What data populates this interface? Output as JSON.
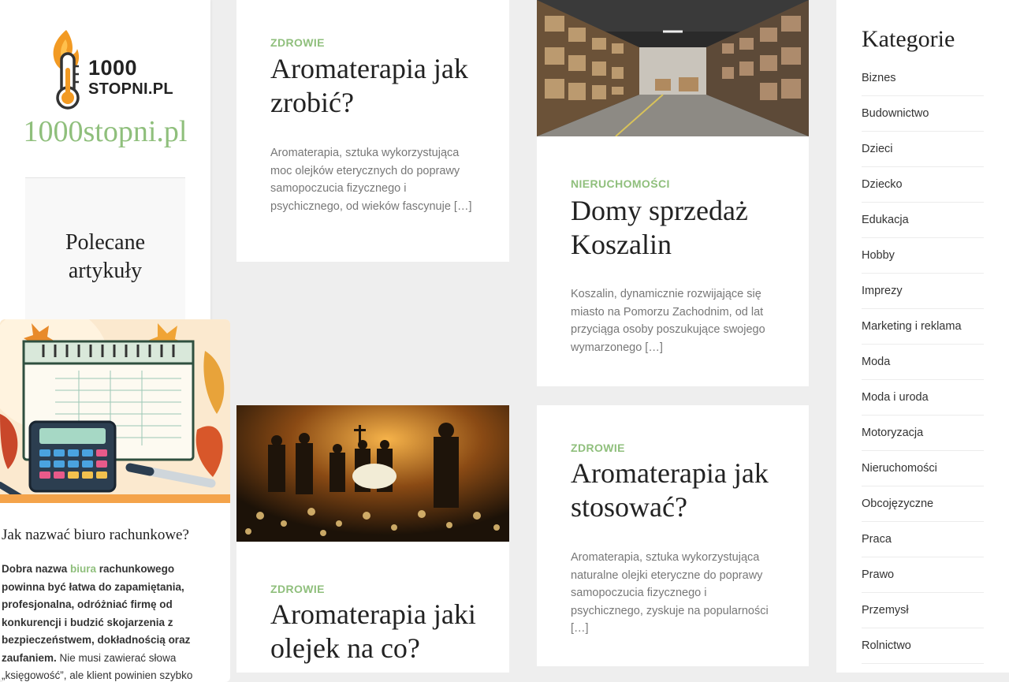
{
  "site": {
    "logo_number": "1000",
    "logo_domain": "STOPNI.PL",
    "title": "1000stopni.pl"
  },
  "featured": {
    "heading_line1": "Polecane",
    "heading_line2": "artykuły",
    "article": {
      "title": "Jak nazwać biuro rachunkowe?",
      "excerpt_bold_1": "Dobra nazwa ",
      "excerpt_link": "biura",
      "excerpt_bold_2": " rachunkowego powinna być łatwa do zapamiętania, profesjonalna, odróżniać firmę od konkurencji i budzić skojarzenia z bezpieczeństwem, dokładnością oraz zaufaniem.",
      "excerpt_rest": " Nie musi zawierać słowa „księgowość”, ale klient powinien szybko"
    }
  },
  "posts": [
    {
      "category": "ZDROWIE",
      "title": "Aromaterapia jak zrobić?",
      "excerpt": "Aromaterapia, sztuka wykorzystująca moc olejków eterycznych do poprawy samopoczucia fizycznego i psychicznego, od wieków fascynuje […]"
    },
    {
      "category": "NIERUCHOMOŚCI",
      "title": "Domy sprzedaż Koszalin",
      "excerpt": "Koszalin, dynamicznie rozwijające się miasto na Pomorzu Zachodnim, od lat przyciąga osoby poszukujące swojego wymarzonego […]"
    },
    {
      "category": "ZDROWIE",
      "title": "Aromaterapia jaki olejek na co?",
      "excerpt": ""
    },
    {
      "category": "ZDROWIE",
      "title": "Aromaterapia jak stosować?",
      "excerpt": "Aromaterapia, sztuka wykorzystująca naturalne olejki eteryczne do poprawy samopoczucia fizycznego i psychicznego, zyskuje na popularności […]"
    }
  ],
  "categories": {
    "heading": "Kategorie",
    "items": [
      "Biznes",
      "Budownictwo",
      "Dzieci",
      "Dziecko",
      "Edukacja",
      "Hobby",
      "Imprezy",
      "Marketing i reklama",
      "Moda",
      "Moda i uroda",
      "Motoryzacja",
      "Nieruchomości",
      "Obcojęzyczne",
      "Praca",
      "Prawo",
      "Przemysł",
      "Rolnictwo"
    ]
  },
  "colors": {
    "accent": "#8fbf7c",
    "background": "#eeeeee",
    "logo_orange": "#f29a23"
  },
  "icons": {
    "logo": "thermometer-flame-icon"
  }
}
